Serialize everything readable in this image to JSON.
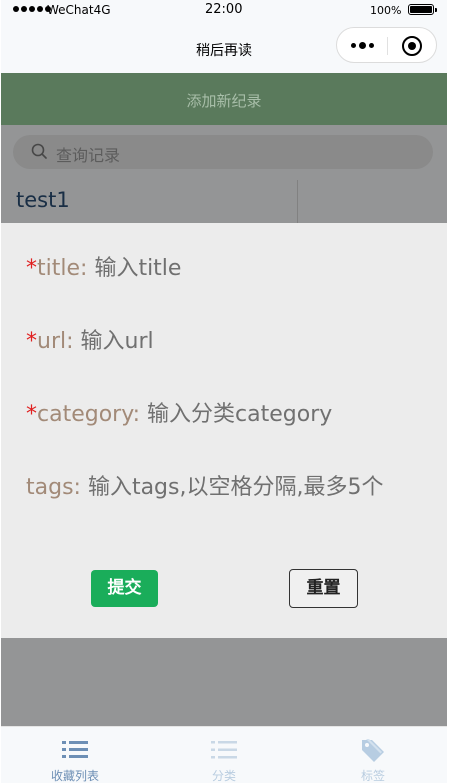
{
  "status_bar": {
    "carrier": "WeChat4G",
    "time": "22:00",
    "battery": "100%"
  },
  "navbar": {
    "title": "稍后再读"
  },
  "add_button": {
    "label": "添加新纪录"
  },
  "search": {
    "placeholder": "查询记录"
  },
  "records": [
    {
      "name": "test1"
    }
  ],
  "form": {
    "fields": [
      {
        "required": "*",
        "label": "title:",
        "placeholder": "输入title"
      },
      {
        "required": "*",
        "label": "url:",
        "placeholder": "输入url"
      },
      {
        "required": "*",
        "label": "category:",
        "placeholder": "输入分类category"
      },
      {
        "required": "",
        "label": "tags:",
        "placeholder": "输入tags,以空格分隔,最多5个"
      }
    ],
    "submit_label": "提交",
    "reset_label": "重置"
  },
  "tabbar": {
    "items": [
      {
        "label": "收藏列表",
        "icon": "list-icon",
        "active": true
      },
      {
        "label": "分类",
        "icon": "category-list-icon",
        "active": false
      },
      {
        "label": "标签",
        "icon": "tag-icon",
        "active": false
      }
    ]
  },
  "colors": {
    "accent_green": "#1aad5a",
    "add_bar": "#5a7a5c",
    "required_star": "#e02020",
    "field_label": "#a28a78",
    "tab_active": "#6d8fb5",
    "tab_inactive": "#b9cde0"
  }
}
